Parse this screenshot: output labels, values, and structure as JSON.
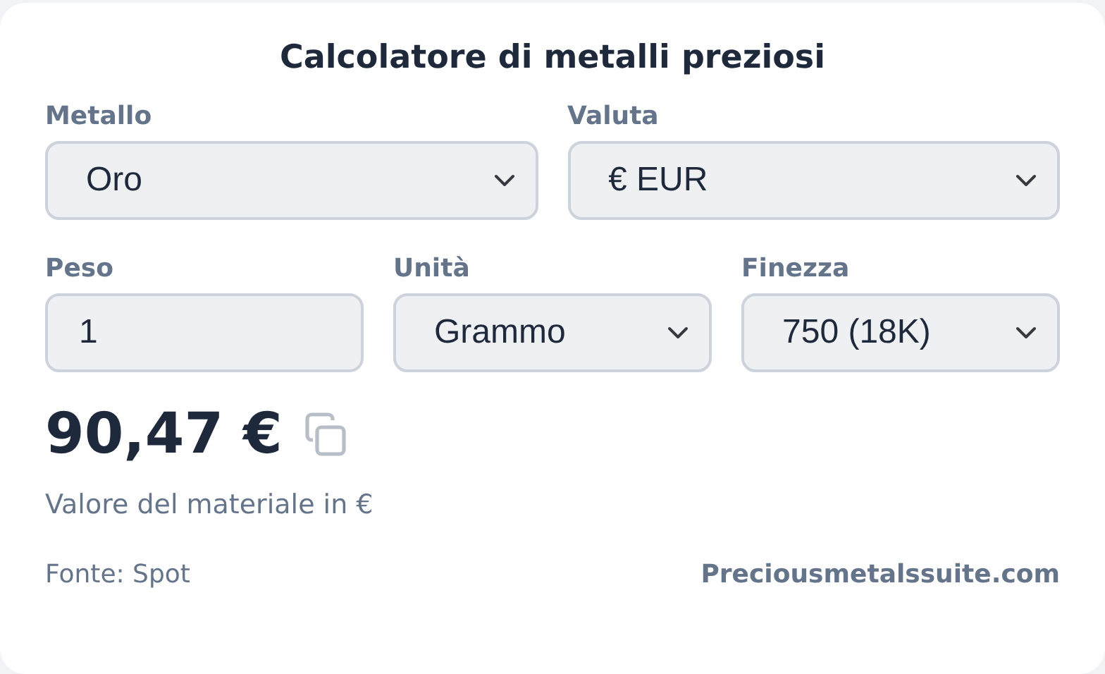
{
  "title": "Calcolatore di metalli preziosi",
  "rows": [
    [
      {
        "kind": "select",
        "label": "Metallo",
        "value": "Oro"
      },
      {
        "kind": "select",
        "label": "Valuta",
        "value": "€ EUR"
      }
    ],
    [
      {
        "kind": "input",
        "label": "Peso",
        "value": "1"
      },
      {
        "kind": "select",
        "label": "Unità",
        "value": "Grammo"
      },
      {
        "kind": "select",
        "label": "Finezza",
        "value": "750 (18K)"
      }
    ]
  ],
  "result": "90,47 €",
  "caption": "Valore del materiale in €",
  "source": "Fonte: Spot",
  "site": "Preciousmetalssuite.com"
}
